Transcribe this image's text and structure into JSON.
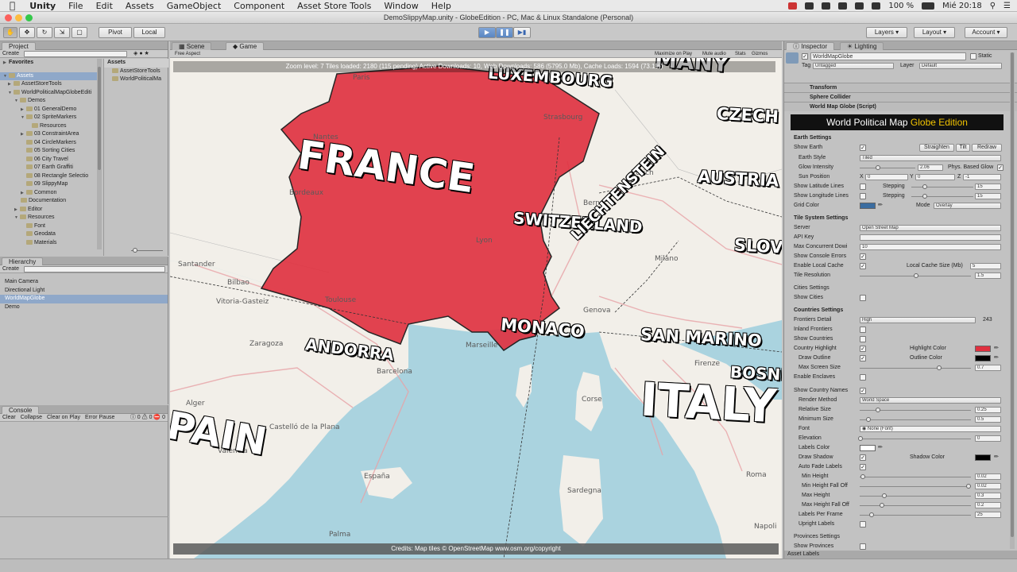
{
  "menubar": {
    "app": "Unity",
    "items": [
      "File",
      "Edit",
      "Assets",
      "GameObject",
      "Component",
      "Asset Store Tools",
      "Window",
      "Help"
    ],
    "battery": "100 %",
    "clock": "Mié 20:18"
  },
  "window": {
    "title": "DemoSlippyMap.unity - GlobeEdition - PC, Mac & Linux Standalone (Personal)"
  },
  "toolbar": {
    "pivot": "Pivot",
    "local": "Local",
    "layers": "Layers",
    "layout": "Layout",
    "account": "Account"
  },
  "project": {
    "tab": "Project",
    "create": "Create",
    "favorites": "Favorites",
    "assets_header": "Assets",
    "tree": [
      "Assets",
      "AssetStoreTools",
      "WorldPoliticalMapGlobeEditi",
      "Demos",
      "01 GeneralDemo",
      "02 SpriteMarkers",
      "Resources",
      "03 ConstraintArea",
      "04 CircleMarkers",
      "05 Sorting Cities",
      "06 City Travel",
      "07 Earth Graffiti",
      "08 Rectangle Selectio",
      "09 SlippyMap",
      "Common",
      "Documentation",
      "Editor",
      "Resources",
      "Font",
      "Geodata",
      "Materials"
    ],
    "files": [
      "AssetStoreTools",
      "WorldPoliticalMa"
    ]
  },
  "hierarchy": {
    "tab": "Hierarchy",
    "create": "Create",
    "items": [
      "Main Camera",
      "Directional Light",
      "WorldMapGlobe",
      "Demo"
    ]
  },
  "console": {
    "tab": "Console",
    "buttons": [
      "Clear",
      "Collapse",
      "Clear on Play",
      "Error Pause"
    ],
    "counts": [
      "0",
      "0",
      "0"
    ]
  },
  "game": {
    "tabs": [
      "Scene",
      "Game"
    ],
    "aspect": "Free Aspect",
    "toolbar": [
      "Maximize on Play",
      "Mute audio",
      "Stats",
      "Gizmos"
    ],
    "status": "Zoom level: 7 Tiles loaded: 2180 (115 pending) Active Downloads: 10, Web Downloads: 586 (5795.0 Mb), Cache Loads: 1594 (73.1%)",
    "credits": "Credits: Map tiles © OpenStreetMap www.osm.org/copyright",
    "labels": {
      "france": "FRANCE",
      "switzerland": "SWITZERLAND",
      "liechtenstein": "LIECHTENSTEIN",
      "monaco": "MONACO",
      "andorra": "ANDORRA",
      "san_marino": "SAN MARINO",
      "italy": "ITALY",
      "spain": "PAIN",
      "czech": "CZECH",
      "austria": "AUSTRIA",
      "slov": "SLOV",
      "luxembourg": "LUXEMBOURG",
      "bosni": "BOSNI",
      "many": "MANY"
    },
    "places": [
      "Santander",
      "Bilbao",
      "Vitoria-Gasteiz",
      "Toulouse",
      "Zaragoza",
      "Barcelona",
      "Valencia",
      "Marseille",
      "Genova",
      "Milano",
      "Firenze",
      "Roma",
      "Corse",
      "Sardegna",
      "España",
      "Napoli",
      "Bern",
      "Lyon",
      "Paris",
      "Strasbourg",
      "Castelló de la Plana",
      "Palma",
      "Alger",
      "Bordeaux",
      "Nantes",
      "Zürich"
    ]
  },
  "inspector": {
    "tabs": [
      "Inspector",
      "Lighting"
    ],
    "object": "WorldMapGlobe",
    "static": "Static",
    "tag_label": "Tag",
    "tag": "Untagged",
    "layer_label": "Layer",
    "layer": "Default",
    "components": [
      "Transform",
      "Sphere Collider",
      "World Map Globe (Script)"
    ],
    "banner_left": "World Political Map ",
    "banner_right": "Globe Edition",
    "earth": {
      "title": "Earth Settings",
      "show_earth": "Show Earth",
      "earth_style": "Earth Style",
      "earth_style_val": "Tiled",
      "glow": "Glow Intensity",
      "glow_val": "2.06",
      "phys": "Phys. Based Glow",
      "sun": "Sun Position",
      "sun_x": "0",
      "sun_y": "0",
      "sun_z": "-1",
      "show_lat": "Show Latitude Lines",
      "show_lon": "Show Longitude Lines",
      "stepping": "Stepping",
      "step_val": "15",
      "grid_color": "Grid Color",
      "mode": "Mode",
      "mode_val": "Overlay",
      "straighten": "Straighten",
      "tilt": "Tilt",
      "redraw": "Redraw"
    },
    "tiles": {
      "title": "Tile System Settings",
      "server": "Server",
      "server_val": "Open Street Map",
      "api": "API Key",
      "max_conc": "Max Concurrent Dowi",
      "max_conc_val": "10",
      "console_err": "Show Console Errors",
      "local_cache": "Enable Local Cache",
      "cache_size": "Local Cache Size (Mb)",
      "cache_size_val": "5",
      "tile_res": "Tile Resolution",
      "tile_res_val": "1.5"
    },
    "cities": {
      "title": "Cities Settings",
      "show": "Show Cities"
    },
    "countries": {
      "title": "Countries Settings",
      "frontiers_detail": "Frontiers Detail",
      "frontiers_val": "High",
      "frontiers_count": "243",
      "inland": "Inland Frontiers",
      "show": "Show Countries",
      "highlight": "Country Highlight",
      "highlight_color": "Highlight Color",
      "draw_outline": "Draw Outline",
      "outline_color": "Outline Color",
      "max_screen": "Max Screen Size",
      "max_screen_val": "0.7",
      "enclaves": "Enable Enclaves",
      "show_names": "Show Country Names",
      "render_method": "Render Method",
      "render_val": "World Space",
      "rel_size": "Relative Size",
      "rel_size_val": "0.25",
      "min_size": "Minimum Size",
      "min_size_val": "0.5",
      "font": "Font",
      "font_val": "None (Font)",
      "elevation": "Elevation",
      "elevation_val": "0",
      "labels_color": "Labels Color",
      "draw_shadow": "Draw Shadow",
      "shadow_color": "Shadow Color",
      "auto_fade": "Auto Fade Labels",
      "min_height": "Min Height",
      "min_height_val": "0.02",
      "min_fall": "Min Height Fall Off",
      "min_fall_val": "0.02",
      "max_height": "Max Height",
      "max_height_val": "0.3",
      "max_fall": "Max Height Fall Off",
      "max_fall_val": "0.2",
      "per_frame": "Labels Per Frame",
      "per_frame_val": "25",
      "upright": "Upright Labels"
    },
    "provinces": {
      "title": "Provinces Settings",
      "show": "Show Provinces"
    },
    "asset_labels": "Asset Labels"
  },
  "colors": {
    "highlight": "#e0303f",
    "banner_accent": "#f2c300"
  }
}
